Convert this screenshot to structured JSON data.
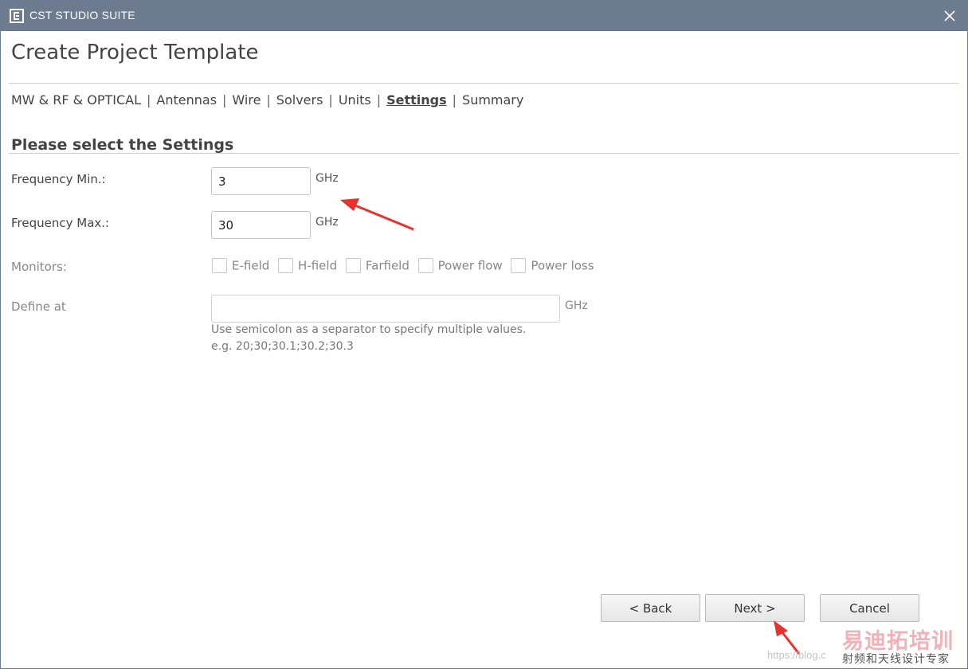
{
  "window": {
    "title": "CST STUDIO SUITE",
    "titlebar_color": "#6d7b8e"
  },
  "page": {
    "title": "Create Project Template"
  },
  "nav": {
    "items": [
      {
        "label": "MW & RF & OPTICAL",
        "active": false
      },
      {
        "label": "Antennas",
        "active": false
      },
      {
        "label": "Wire",
        "active": false
      },
      {
        "label": "Solvers",
        "active": false
      },
      {
        "label": "Units",
        "active": false
      },
      {
        "label": "Settings",
        "active": true
      },
      {
        "label": "Summary",
        "active": false
      }
    ],
    "separator": "|"
  },
  "section": {
    "title": "Please select the Settings"
  },
  "form": {
    "freq_min": {
      "label": "Frequency Min.:",
      "value": "3",
      "unit": "GHz"
    },
    "freq_max": {
      "label": "Frequency Max.:",
      "value": "30",
      "unit": "GHz"
    },
    "monitors": {
      "label": "Monitors:",
      "options": [
        {
          "label": "E-field",
          "checked": false
        },
        {
          "label": "H-field",
          "checked": false
        },
        {
          "label": "Farfield",
          "checked": false
        },
        {
          "label": "Power flow",
          "checked": false
        },
        {
          "label": "Power loss",
          "checked": false
        }
      ]
    },
    "define_at": {
      "label": "Define at",
      "value": "",
      "unit": "GHz",
      "hint_line1": "Use semicolon as a separator to specify multiple values.",
      "hint_line2": "e.g. 20;30;30.1;30.2;30.3"
    }
  },
  "buttons": {
    "back": "< Back",
    "next": "Next >",
    "cancel": "Cancel"
  },
  "annotations": {
    "arrow_color": "#e8322c"
  },
  "watermark": {
    "url": "https://blog.c",
    "brand": "易迪拓培训",
    "subtitle": "射频和天线设计专家"
  }
}
